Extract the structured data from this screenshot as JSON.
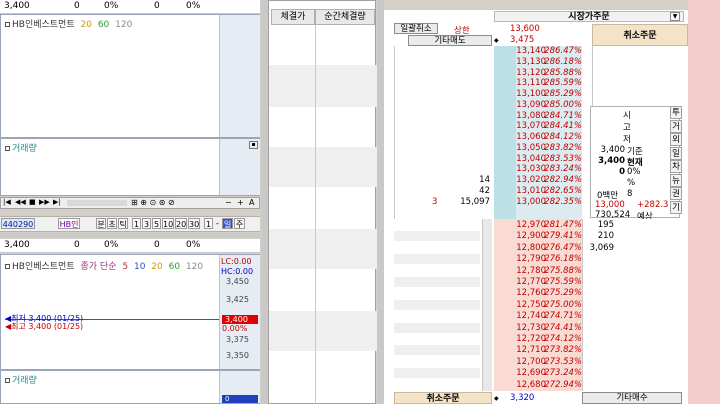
{
  "top_panel": {
    "strip": [
      "3,400",
      "0",
      "0%",
      "0",
      "0%"
    ],
    "legend": {
      "name": "HB인베스트먼트",
      "ma": [
        "20",
        "60",
        "120"
      ]
    },
    "volume_label": "거래량"
  },
  "toolbar": {
    "code": "440290",
    "name": "HB인",
    "periods": [
      "분",
      "초",
      "틱",
      "1",
      "3",
      "5",
      "10",
      "20",
      "30",
      "1",
      "-",
      "일",
      "주"
    ]
  },
  "bottom_panel": {
    "strip": [
      "3,400",
      "0",
      "0%",
      "0",
      "0%"
    ],
    "legend": {
      "name": "HB인베스트먼트",
      "mode": "종가 단순",
      "ma": [
        "5",
        "10",
        "20",
        "60",
        "120"
      ]
    },
    "lc": "LC:0.00",
    "hc": "HC:0.00",
    "scale": [
      "3,450",
      "3,425",
      "3,400",
      "3,375",
      "3,350"
    ],
    "scale_pct": "0.00%",
    "marker_high": "최저 3,400 (01/25)",
    "marker_low": "최고 3,400 (01/25)",
    "volume_label": "거래량",
    "volume_value": "0"
  },
  "trades": {
    "headers": [
      "체결가",
      "순간체결량"
    ]
  },
  "book": {
    "title": "시장가주문",
    "bulk_cancel": "일괄취소",
    "upper_limit_label": "상한",
    "upper_limit": "13,600",
    "upper_value": "3,475",
    "sell_other": "기타매도",
    "cancel_order": "취소주문",
    "cancel_order_bottom": "취소주문",
    "buy_other": "기타매수",
    "bottom_price": "3,320",
    "asks": [
      {
        "price": "13,140",
        "pct": "286.47%"
      },
      {
        "price": "13,130",
        "pct": "286.18%"
      },
      {
        "price": "13,120",
        "pct": "285.88%"
      },
      {
        "price": "13,110",
        "pct": "285.59%"
      },
      {
        "price": "13,100",
        "pct": "285.29%"
      },
      {
        "price": "13,090",
        "pct": "285.00%"
      },
      {
        "price": "13,080",
        "pct": "284.71%"
      },
      {
        "price": "13,070",
        "pct": "284.41%"
      },
      {
        "price": "13,060",
        "pct": "284.12%"
      },
      {
        "price": "13,050",
        "pct": "283.82%"
      },
      {
        "price": "13,040",
        "pct": "283.53%"
      },
      {
        "price": "13,030",
        "pct": "283.24%"
      },
      {
        "price": "13,020",
        "pct": "282.94%",
        "qty": "14"
      },
      {
        "price": "13,010",
        "pct": "282.65%",
        "qty": "42"
      },
      {
        "price": "13,000",
        "pct": "282.35%",
        "qty": "15,097",
        "left": "3"
      }
    ],
    "bids": [
      {
        "price": "12,970",
        "pct": "281.47%",
        "qty": "195"
      },
      {
        "price": "12,900",
        "pct": "279.41%",
        "qty": "210"
      },
      {
        "price": "12,800",
        "pct": "276.47%",
        "qty": "3,069"
      },
      {
        "price": "12,790",
        "pct": "276.18%"
      },
      {
        "price": "12,780",
        "pct": "275.88%"
      },
      {
        "price": "12,770",
        "pct": "275.59%"
      },
      {
        "price": "12,760",
        "pct": "275.29%"
      },
      {
        "price": "12,750",
        "pct": "275.00%"
      },
      {
        "price": "12,740",
        "pct": "274.71%"
      },
      {
        "price": "12,730",
        "pct": "274.41%"
      },
      {
        "price": "12,720",
        "pct": "274.12%"
      },
      {
        "price": "12,710",
        "pct": "273.82%"
      },
      {
        "price": "12,700",
        "pct": "273.53%"
      },
      {
        "price": "12,690",
        "pct": "273.24%"
      },
      {
        "price": "12,680",
        "pct": "272.94%"
      }
    ],
    "info": {
      "labels": [
        "시",
        "고",
        "저"
      ],
      "base_value": "3,400",
      "base_label": "기준",
      "current_value": "3,400",
      "current_label": "현재",
      "rate": "0",
      "rate_unit": "0%",
      "vol_pct": "%",
      "amount_label": "0백만",
      "amount_value": "8",
      "expected_price": "13,000",
      "expected_change": "+282.3",
      "expected_qty": "730,524",
      "expected_label": "예상"
    },
    "side_tabs": [
      "투",
      "거",
      "외",
      "일",
      "차",
      "뉴",
      "권",
      "기"
    ]
  }
}
